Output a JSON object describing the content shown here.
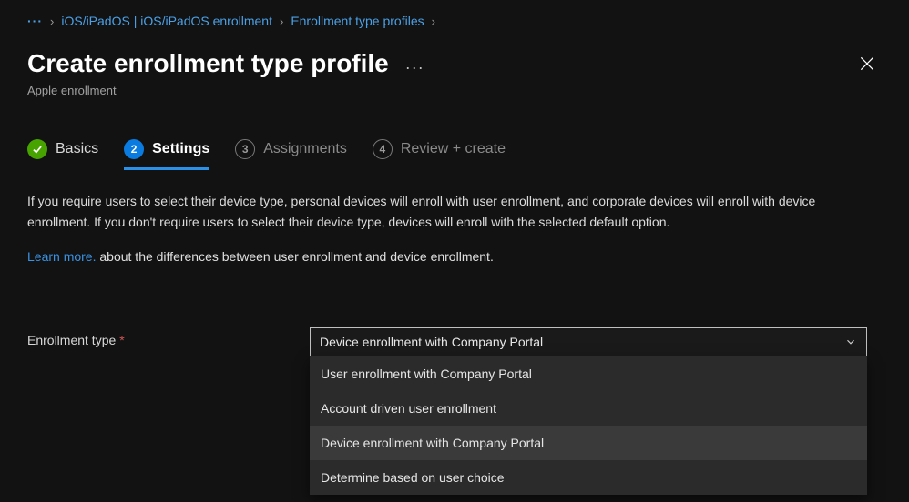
{
  "breadcrumb": {
    "items": [
      "iOS/iPadOS | iOS/iPadOS enrollment",
      "Enrollment type profiles"
    ]
  },
  "header": {
    "title": "Create enrollment type profile",
    "subtitle": "Apple enrollment"
  },
  "steps": {
    "s1": {
      "num": "1",
      "label": "Basics"
    },
    "s2": {
      "num": "2",
      "label": "Settings"
    },
    "s3": {
      "num": "3",
      "label": "Assignments"
    },
    "s4": {
      "num": "4",
      "label": "Review + create"
    }
  },
  "description": "If you require users to select their device type, personal devices will enroll with user enrollment, and corporate devices will enroll with device enrollment. If you don't require users to select their device type, devices will enroll with the selected default option.",
  "learn": {
    "link": "Learn more.",
    "rest": " about the differences between user enrollment and device enrollment."
  },
  "form": {
    "enrollment_type_label": "Enrollment type",
    "required_marker": "*",
    "selected": "Device enrollment with Company Portal",
    "options": {
      "o1": "User enrollment with Company Portal",
      "o2": "Account driven user enrollment",
      "o3": "Device enrollment with Company Portal",
      "o4": "Determine based on user choice"
    }
  }
}
